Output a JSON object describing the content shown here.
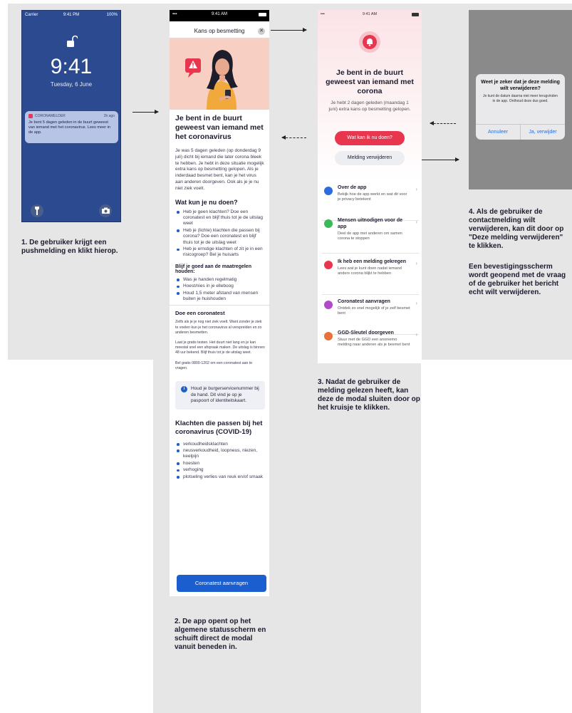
{
  "lock_screen": {
    "carrier": "Carrier",
    "status_time": "9:41 PM",
    "battery": "100%",
    "time": "9:41",
    "date": "Tuesday, 6 June",
    "notification": {
      "app": "CORONAMELDER",
      "age": "2h ago",
      "message": "Je bent 5 dagen geleden in de buurt geweest van iemand met het coronavirus. Lees meer in de app."
    }
  },
  "captions": {
    "step1": "1. De gebruiker krijgt een pushmelding en klikt hierop.",
    "step2": "2. De app opent op het algemene statusscherm en schuift direct de modal vanuit beneden in.",
    "step3": "3. Nadat de gebruiker de melding gelezen heeft, kan deze de modal sluiten door op het kruisje te klikken.",
    "step4a": "4. Als de gebruiker de contactmelding wilt verwijderen, kan dit door op \"Deze melding verwijderen\" te klikken.",
    "step4b": "Een bevestigingsscherm wordt geopend met de vraag of de gebruiker het bericht echt wilt verwijderen."
  },
  "modal": {
    "status_time": "9:41 AM",
    "header_title": "Kans op besmetting",
    "close_icon": "✕",
    "title": "Je bent in de buurt geweest van iemand met het coronavirus",
    "intro": "Je was 5 dagen geleden (op donderdag 9 juli) dicht bij iemand die later corona bleek te hebben. Je hebt in deze situatie mogelijk extra kans op besmetting gelopen. Als je inderdaad besmet bent, kan je het virus aan anderen doorgeven. Ook als je je nu niet ziek voelt.",
    "what_heading": "Wat kun je nu doen?",
    "what_items": [
      "Heb je geen klachten? Doe een coronatest en blijf thuis tot je de uitslag weet",
      "Heb je (lichte) klachten die passen bij corona? Doe een coronatest en blijf thuis tot je de uitslag weet",
      "Heb je ernstige klachten of zit je in een risicogroep? Bel je huisarts"
    ],
    "measures_heading": "Blijf je goed aan de maatregelen houden:",
    "measures_items": [
      "Was je handen regelmatig",
      "Hoest/nies in je elleboog",
      "Houd 1,5 meter afstand van mensen buiten je huishouden"
    ],
    "test_heading": "Doe een coronatest",
    "test_p1": "Zelfs als je je nog niet ziek voelt. Want zonder je ziek te voelen kun je het coronavirus al verspreiden en zo anderen besmetten.",
    "test_p2": "Laat je gratis testen. Het duurt niet lang en je kan meestal snel een afspraak maken. De uitslag is binnen 48 uur bekend. Blijf thuis tot je de uitslag weet.",
    "test_p3": "Bel gratis 0800-1202 om een coronatest aan te vragen.",
    "info_icon": "i",
    "info_text": "Houd je burgerservicenummer bij de hand. Dit vind je op je paspoort of identiteitskaart.",
    "symptoms_heading": "Klachten die passen bij het coronavirus (COVID-19)",
    "symptoms": [
      "verkoudheidsklachten",
      "neusverkoudheid, loopneus, niezen, keelpijn",
      "hoesten",
      "verhoging",
      "plotseling verlies van reuk en/of smaak"
    ],
    "cta_label": "Coronatest aanvragen"
  },
  "status_screen": {
    "status_time": "9:41 AM",
    "title": "Je bent in de buurt geweest van iemand met corona",
    "subtitle": "Je hebt 2 dagen geleden (maandag 1 juni) extra kans op besmetting gelopen.",
    "primary_button": "Wat kan ik nu doen?",
    "secondary_button": "Melding verwijderen",
    "items": [
      {
        "title": "Over de app",
        "desc": "Bekijk hoe de app werkt en wat dit voor je privacy betekent",
        "icon": "info-icon",
        "color": "#2d6cdf"
      },
      {
        "title": "Mensen uitnodigen voor de app",
        "desc": "Deel de app met anderen om samen corona te stoppen",
        "icon": "share-icon",
        "color": "#3bb85a"
      },
      {
        "title": "Ik heb een melding gekregen",
        "desc": "Lees wat je kunt doen nadat iemand anders corona blijkt te hebben",
        "icon": "notification-icon",
        "color": "#e8364f"
      },
      {
        "title": "Coronatest aanvragen",
        "desc": "Ontdek zo snel mogelijk of je zelf besmet bent",
        "icon": "test-icon",
        "color": "#b04ac8"
      },
      {
        "title": "GGD-Sleutel doorgeven",
        "desc": "Stuur met de GGD een anoniemo melding naar anderen als je besmet bent",
        "icon": "key-icon",
        "color": "#e8703a"
      }
    ]
  },
  "confirm": {
    "title": "Weet je zeker dat je deze melding wilt verwijderen?",
    "body": "Je kunt de datum daarna niet meer terugvinden in de app. Onthoud deze dus goed.",
    "cancel": "Annuleer",
    "confirm": "Ja, verwijder"
  }
}
